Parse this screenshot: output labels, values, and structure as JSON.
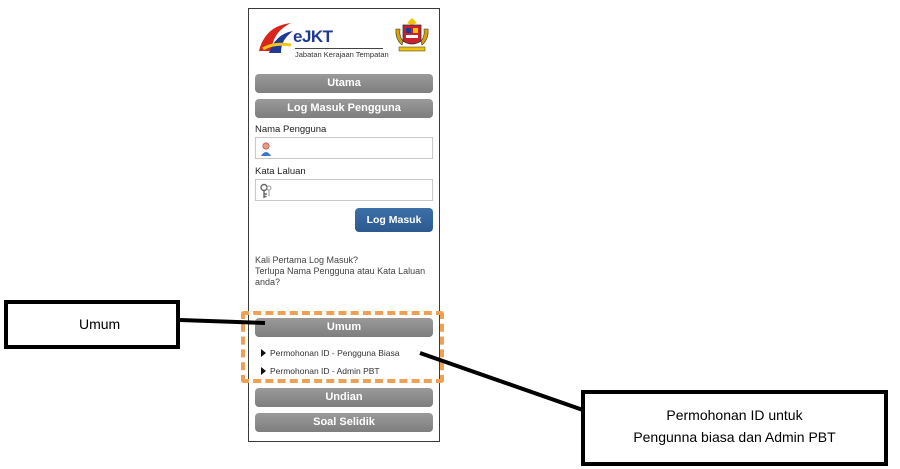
{
  "brand": {
    "name": "eJKT",
    "subtitle": "Jabatan Kerajaan Tempatan",
    "logo_icon": "ejkt-logo-icon",
    "crest_icon": "malaysia-crest-icon"
  },
  "nav": {
    "home_label": "Utama",
    "login_header_label": "Log Masuk Pengguna"
  },
  "login": {
    "username_label": "Nama Pengguna",
    "username_value": "",
    "username_icon": "user-icon",
    "password_label": "Kata Laluan",
    "password_value": "",
    "password_icon": "key-icon",
    "submit_label": "Log Masuk"
  },
  "help_links": {
    "first_time": "Kali Pertama Log Masuk?",
    "forgot": "Terlupa Nama Pengguna atau Kata Laluan anda?"
  },
  "general": {
    "section_label": "Umum",
    "items": [
      {
        "label": "Permohonan ID - Pengguna Biasa"
      },
      {
        "label": "Permohonan ID - Admin PBT"
      }
    ]
  },
  "extra_nav": {
    "undian_label": "Undian",
    "survey_label": "Soal Selidik"
  },
  "annotations": {
    "umum_callout": "Umum",
    "permohonan_callout_line1": "Permohonan ID untuk",
    "permohonan_callout_line2": "Pengunna biasa dan Admin PBT",
    "highlight_color": "#f0a052"
  },
  "colors": {
    "gray_button": "#888888",
    "login_button": "#2f5f96",
    "brand_blue": "#1f3a93"
  }
}
